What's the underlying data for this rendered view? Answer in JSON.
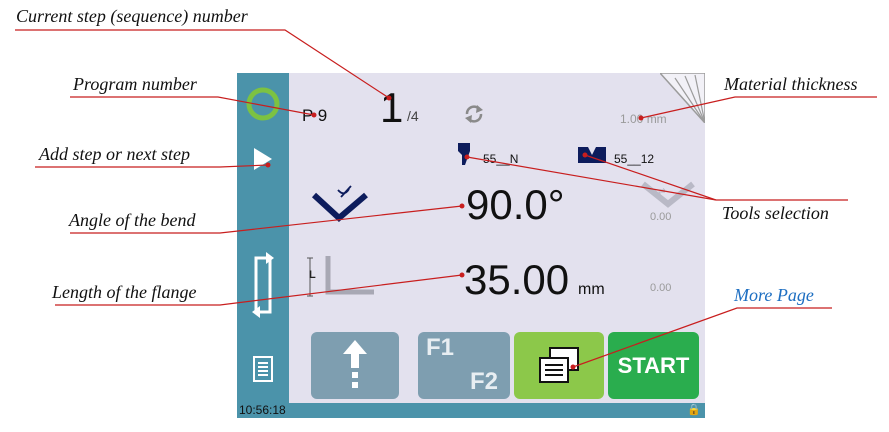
{
  "annotations": {
    "current_step": "Current step (sequence) number",
    "program_number": "Program number",
    "material_thickness": "Material thickness",
    "add_step": "Add step or next step",
    "angle": "Angle of the bend",
    "tools_selection": "Tools selection",
    "flange_length": "Length of the flange",
    "more_page": "More Page"
  },
  "header": {
    "program": "P 9",
    "step_current": "1",
    "step_total": "/4",
    "thickness": "1.00 mm"
  },
  "tools": {
    "punch": "55__N",
    "die": "55__12"
  },
  "bend": {
    "angle": "90.0°",
    "angle_correction": "0.00",
    "length_value": "35.00",
    "length_unit": "mm",
    "length_correction": "0.00",
    "length_axis_label": "L"
  },
  "buttons": {
    "f1": "F1",
    "f2": "F2",
    "start": "START"
  },
  "status": {
    "time": "10:56:18"
  },
  "colors": {
    "sidebar": "#4b93aa",
    "screen_bg": "#e3e1ee",
    "green": "#2aad4e",
    "light_green": "#8cc84a",
    "gray_button": "#7e9eb0",
    "annotation_line": "#c81e1e",
    "link_blue": "#1e6fc2"
  }
}
